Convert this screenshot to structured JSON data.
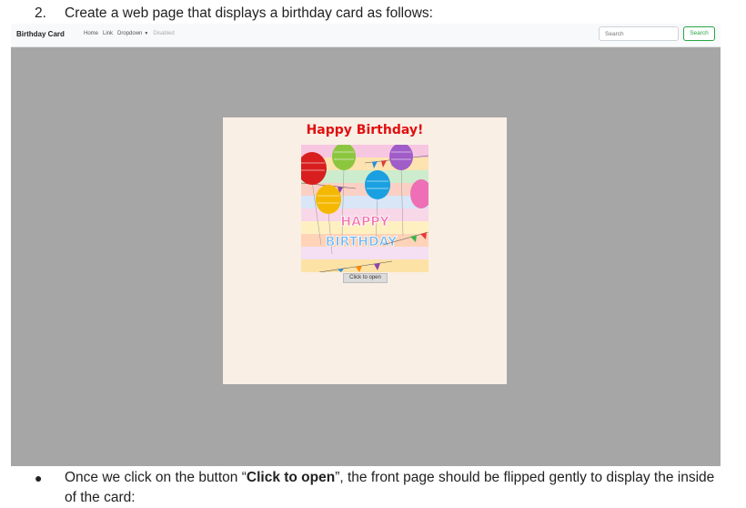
{
  "doc": {
    "number": "2.",
    "heading": "Create a web page that displays a birthday card as follows:",
    "bullet_prefix": "Once we click on the button “",
    "bullet_bold": "Click to open",
    "bullet_suffix": "”, the front page should be flipped gently to display the inside of the card:"
  },
  "navbar": {
    "brand": "Birthday Card",
    "links": [
      "Home",
      "Link",
      "Dropdown",
      "Disabled"
    ],
    "search_placeholder": "Search",
    "search_button": "Search"
  },
  "card": {
    "title": "Happy Birthday!",
    "image_text_line1": "HAPPY",
    "image_text_line2": "BIRTHDAY",
    "button": "Click to open"
  },
  "colors": {
    "title": "#e11010",
    "card_bg": "#faefe5",
    "page_bg": "#a6a6a6",
    "search_green": "#28a745"
  }
}
